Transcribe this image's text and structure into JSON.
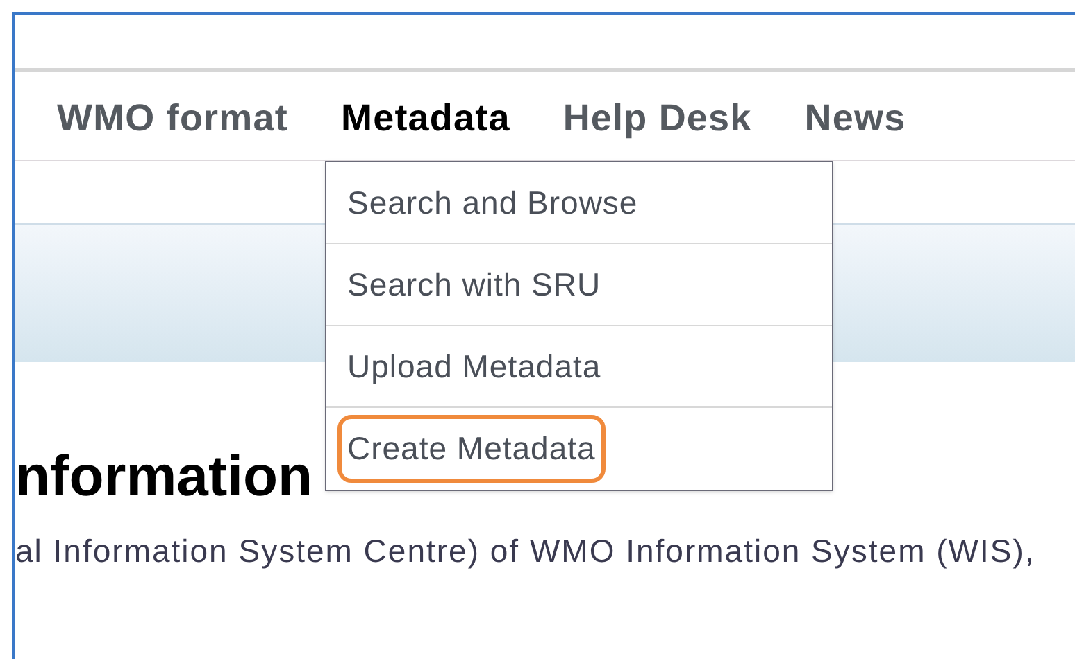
{
  "nav": [
    {
      "label": "WMO format",
      "selected": false
    },
    {
      "label": "Metadata",
      "selected": true
    },
    {
      "label": "Help Desk",
      "selected": false
    },
    {
      "label": "News",
      "selected": false
    }
  ],
  "dropdown": [
    {
      "label": "Search and Browse",
      "annotated": false
    },
    {
      "label": "Search with SRU",
      "annotated": false
    },
    {
      "label": "Upload Metadata",
      "annotated": false
    },
    {
      "label": "Create Metadata",
      "annotated": true
    }
  ],
  "heading": "nformation",
  "paragraph": "al Information System Centre) of WMO Information System (WIS),"
}
